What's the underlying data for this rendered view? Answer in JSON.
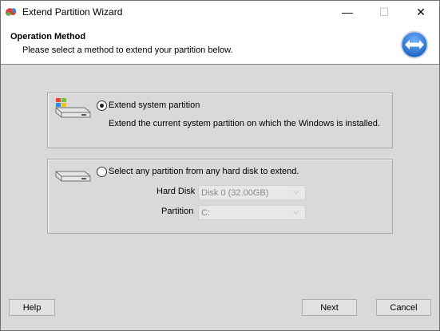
{
  "window": {
    "title": "Extend Partition Wizard",
    "controls": {
      "minimize": "—",
      "maximize": "☐",
      "close": "✕"
    }
  },
  "header": {
    "title": "Operation Method",
    "subtitle": "Please select a method to extend your partition below."
  },
  "options": {
    "extend_system": {
      "label": "Extend system partition",
      "description": "Extend the current system partition on which the Windows is installed.",
      "selected": true
    },
    "any_partition": {
      "label": "Select any partition from any hard disk to extend.",
      "selected": false,
      "hard_disk_label": "Hard Disk",
      "hard_disk_value": "Disk 0 (32.00GB)",
      "partition_label": "Partition",
      "partition_value": "C:"
    }
  },
  "footer": {
    "help_label": "Help",
    "next_label": "Next",
    "cancel_label": "Cancel"
  }
}
